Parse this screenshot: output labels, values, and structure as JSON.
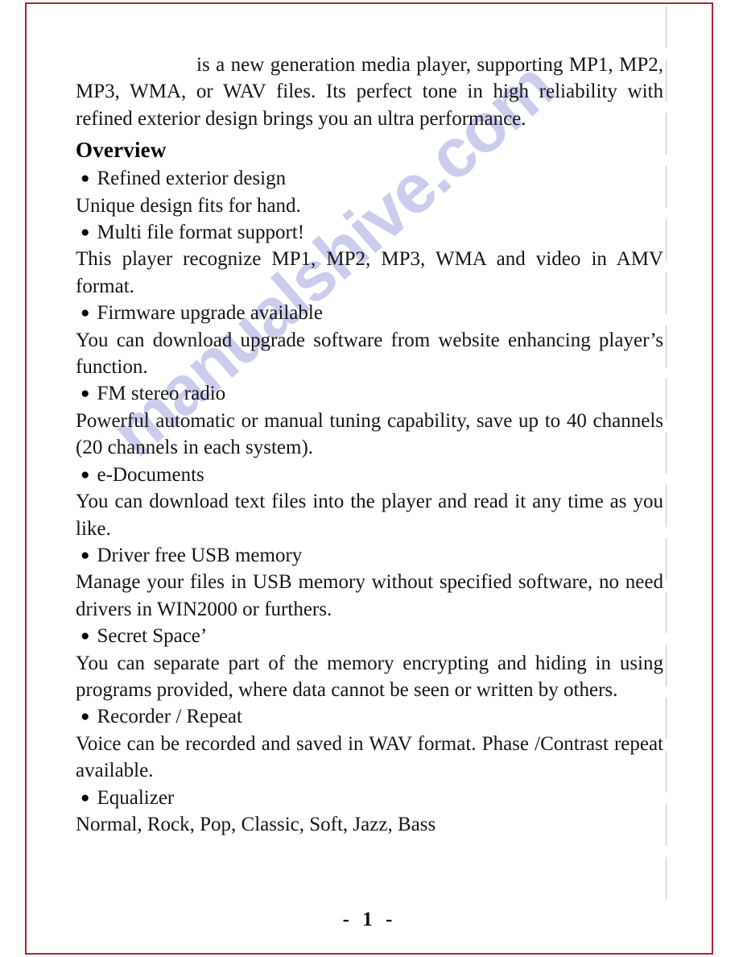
{
  "page": {
    "number_label": "- 1 -",
    "frame_color": "#a62834",
    "background_color": "#ffffff",
    "text_color": "#161616"
  },
  "watermark": {
    "text": "manualshive.com",
    "color": "#b9bbe6"
  },
  "intro": {
    "text": "is a new generation media player, supporting MP1, MP2, MP3, WMA, or WAV  files. Its perfect tone in high reliability with refined exterior design  brings you an ultra performance."
  },
  "overview": {
    "heading": "Overview",
    "bullet_glyph": "●",
    "items": [
      {
        "title": "Refined exterior design",
        "body": "Unique design fits for hand."
      },
      {
        "title": "Multi file format support!",
        "body": "This player recognize MP1, MP2, MP3, WMA and video in AMV format."
      },
      {
        "title": "Firmware upgrade available",
        "body": "You can download upgrade software from website enhancing player’s function."
      },
      {
        "title": "FM stereo radio",
        "body": "Powerful automatic  or manual  tuning capability,  save  up to  40 channels (20 channels in each system)."
      },
      {
        "title": "e-Documents",
        "body": "You  can download text  files into the  player and read it  any time as you like."
      },
      {
        "title": "Driver free USB memory",
        "body": "Manage your  files  in USB  memory  without specified software, no need  drivers in WIN2000 or  furthers."
      },
      {
        "title": "Secret Space’",
        "body": "You  can  separate part of  the memory  encrypting and  hiding  in using programs provided, where data cannot be seen or written by others."
      },
      {
        "title": "Recorder / Repeat",
        "body": "Voice can be recorded and saved in WAV format. Phase /Contrast repeat available."
      },
      {
        "title": "Equalizer",
        "body": "Normal, Rock, Pop, Classic, Soft, Jazz, Bass"
      }
    ]
  }
}
